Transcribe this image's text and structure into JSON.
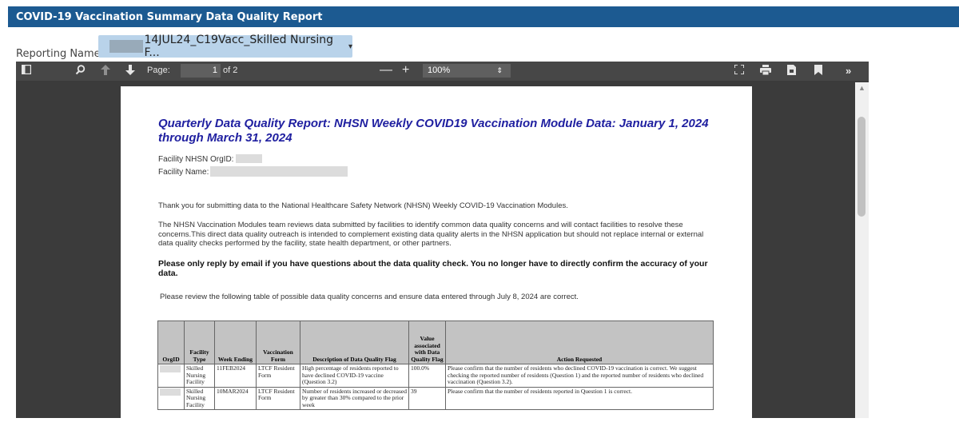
{
  "app": {
    "title": "COVID-19 Vaccination Summary Data Quality Report"
  },
  "reporting": {
    "label": "Reporting Name:",
    "selected": "14JUL24_C19Vacc_Skilled Nursing F...",
    "caret": "▾"
  },
  "toolbar": {
    "page_label": "Page:",
    "page_current": "1",
    "page_of": "of 2",
    "zoom": "100%",
    "zoom_caret": "⇕"
  },
  "document": {
    "title": "Quarterly Data Quality Report: NHSN Weekly COVID19 Vaccination Module Data: January 1, 2024 through March 31, 2024",
    "facility_orgid_label": "Facility NHSN OrgID:",
    "facility_name_label": "Facility Name:",
    "para1": "Thank you for submitting data to the National Healthcare Safety Network (NHSN) Weekly COVID-19 Vaccination Modules.",
    "para2": "The NHSN Vaccination Modules team reviews data submitted by facilities to identify common data quality concerns and will contact facilities to resolve these concerns.This direct data quality outreach is intended to complement existing data quality alerts in the NHSN application but should not replace internal or external data quality checks performed by the facility, state health department, or other partners.",
    "bold_para": "Please only reply by email if you have questions about the data quality check. You no longer have to directly confirm the accuracy of your data.",
    "para3": "Please review the following table of possible data quality concerns and ensure data entered through July 8, 2024 are correct."
  },
  "table": {
    "headers": [
      "OrgID",
      "Facility Type",
      "Week Ending",
      "Vaccination Form",
      "Description of Data Quality Flag",
      "Value associated with Data Quality Flag",
      "Action Requested"
    ],
    "rows": [
      {
        "facility_type": "Skilled Nursing Facility",
        "week_ending": "11FEB2024",
        "form": "LTCF Resident Form",
        "description": "High percentage of residents reported to have declined COVID-19 vaccine (Question 3.2)",
        "value": "100.0%",
        "action": "Please confirm that the number of residents who declined COVID-19 vaccination is correct. We suggest checking the reported number of residents (Question 1) and the reported number of residents who declined vaccination (Question 3.2)."
      },
      {
        "facility_type": "Skilled Nursing Facility",
        "week_ending": "10MAR2024",
        "form": "LTCF Resident Form",
        "description": "Number of residents increased or decreased by greater than 30% compared to the prior week",
        "value": "39",
        "action": "Please confirm that the number of residents reported in Question 1 is correct."
      }
    ]
  }
}
